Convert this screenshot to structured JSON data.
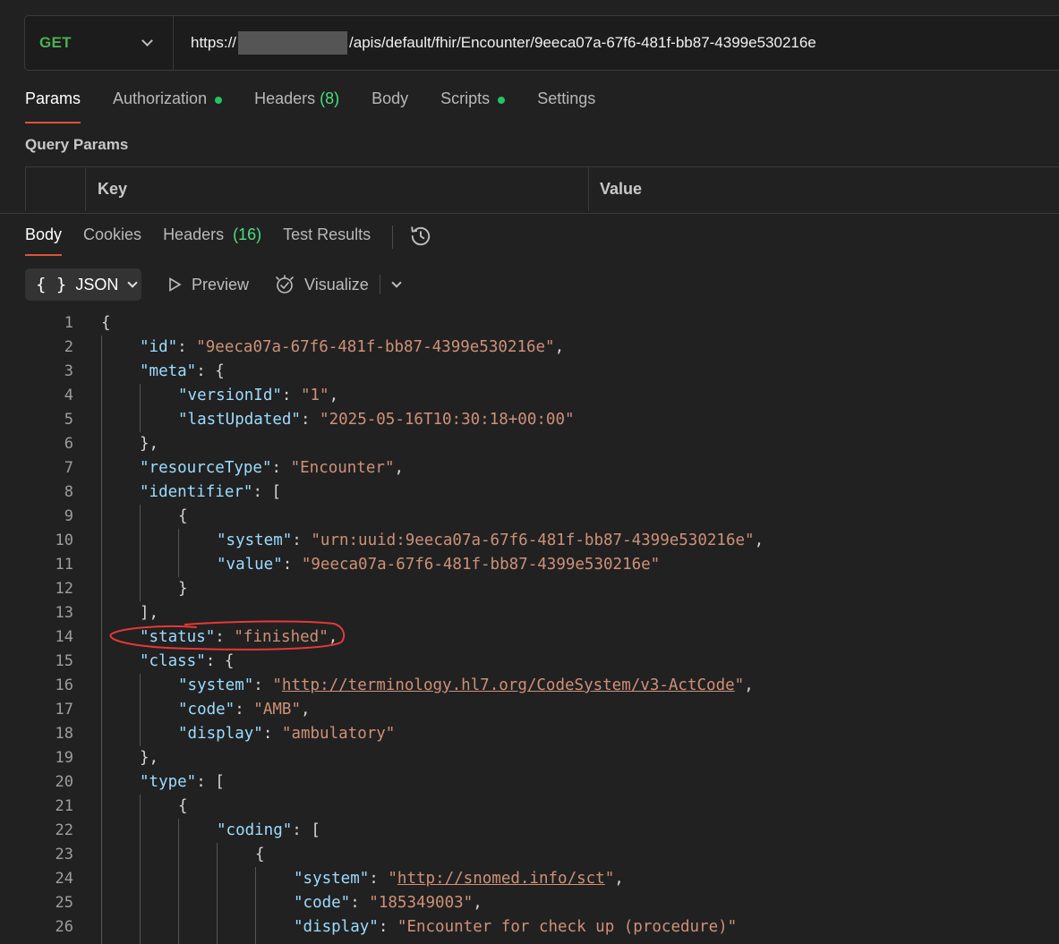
{
  "request": {
    "method": "GET",
    "url_prefix": "https://",
    "url_suffix": "/apis/default/fhir/Encounter/9eeca07a-67f6-481f-bb87-4399e530216e"
  },
  "request_tabs": {
    "params": "Params",
    "authorization": "Authorization",
    "headers": "Headers",
    "headers_count": "(8)",
    "body": "Body",
    "scripts": "Scripts",
    "settings": "Settings"
  },
  "query_params": {
    "title": "Query Params",
    "key_header": "Key",
    "value_header": "Value"
  },
  "response_tabs": {
    "body": "Body",
    "cookies": "Cookies",
    "headers": "Headers",
    "headers_count": "(16)",
    "test_results": "Test Results"
  },
  "toolbar": {
    "format": "JSON",
    "preview": "Preview",
    "visualize": "Visualize"
  },
  "colors": {
    "accent": "#e0533a",
    "method_green": "#4caf50",
    "dot_green": "#22c55e",
    "json_key": "#9cdcfe",
    "json_string": "#ce9178",
    "annotation_red": "#e53935"
  },
  "code_lines": [
    {
      "n": "1",
      "tokens": [
        [
          "p",
          "{"
        ]
      ]
    },
    {
      "n": "2",
      "tokens": [
        [
          "k",
          "\"id\""
        ],
        [
          "p",
          ": "
        ],
        [
          "s",
          "\"9eeca07a-67f6-481f-bb87-4399e530216e\""
        ],
        [
          "p",
          ","
        ]
      ]
    },
    {
      "n": "3",
      "tokens": [
        [
          "k",
          "\"meta\""
        ],
        [
          "p",
          ": {"
        ]
      ]
    },
    {
      "n": "4",
      "tokens": [
        [
          "k",
          "\"versionId\""
        ],
        [
          "p",
          ": "
        ],
        [
          "s",
          "\"1\""
        ],
        [
          "p",
          ","
        ]
      ]
    },
    {
      "n": "5",
      "tokens": [
        [
          "k",
          "\"lastUpdated\""
        ],
        [
          "p",
          ": "
        ],
        [
          "s",
          "\"2025-05-16T10:30:18+00:00\""
        ]
      ]
    },
    {
      "n": "6",
      "tokens": [
        [
          "p",
          "},"
        ]
      ]
    },
    {
      "n": "7",
      "tokens": [
        [
          "k",
          "\"resourceType\""
        ],
        [
          "p",
          ": "
        ],
        [
          "s",
          "\"Encounter\""
        ],
        [
          "p",
          ","
        ]
      ]
    },
    {
      "n": "8",
      "tokens": [
        [
          "k",
          "\"identifier\""
        ],
        [
          "p",
          ": ["
        ]
      ]
    },
    {
      "n": "9",
      "tokens": [
        [
          "p",
          "{"
        ]
      ]
    },
    {
      "n": "10",
      "tokens": [
        [
          "k",
          "\"system\""
        ],
        [
          "p",
          ": "
        ],
        [
          "s",
          "\"urn:uuid:9eeca07a-67f6-481f-bb87-4399e530216e\""
        ],
        [
          "p",
          ","
        ]
      ]
    },
    {
      "n": "11",
      "tokens": [
        [
          "k",
          "\"value\""
        ],
        [
          "p",
          ": "
        ],
        [
          "s",
          "\"9eeca07a-67f6-481f-bb87-4399e530216e\""
        ]
      ]
    },
    {
      "n": "12",
      "tokens": [
        [
          "p",
          "}"
        ]
      ]
    },
    {
      "n": "13",
      "tokens": [
        [
          "p",
          "],"
        ]
      ]
    },
    {
      "n": "14",
      "tokens": [
        [
          "k",
          "\"status\""
        ],
        [
          "p",
          ": "
        ],
        [
          "s",
          "\"finished\""
        ],
        [
          "p",
          ","
        ]
      ]
    },
    {
      "n": "15",
      "tokens": [
        [
          "k",
          "\"class\""
        ],
        [
          "p",
          ": {"
        ]
      ]
    },
    {
      "n": "16",
      "tokens": [
        [
          "k",
          "\"system\""
        ],
        [
          "p",
          ": "
        ],
        [
          "s",
          "\""
        ],
        [
          "link",
          "http://terminology.hl7.org/CodeSystem/v3-ActCode"
        ],
        [
          "s",
          "\""
        ],
        [
          "p",
          ","
        ]
      ]
    },
    {
      "n": "17",
      "tokens": [
        [
          "k",
          "\"code\""
        ],
        [
          "p",
          ": "
        ],
        [
          "s",
          "\"AMB\""
        ],
        [
          "p",
          ","
        ]
      ]
    },
    {
      "n": "18",
      "tokens": [
        [
          "k",
          "\"display\""
        ],
        [
          "p",
          ": "
        ],
        [
          "s",
          "\"ambulatory\""
        ]
      ]
    },
    {
      "n": "19",
      "tokens": [
        [
          "p",
          "},"
        ]
      ]
    },
    {
      "n": "20",
      "tokens": [
        [
          "k",
          "\"type\""
        ],
        [
          "p",
          ": ["
        ]
      ]
    },
    {
      "n": "21",
      "tokens": [
        [
          "p",
          "{"
        ]
      ]
    },
    {
      "n": "22",
      "tokens": [
        [
          "k",
          "\"coding\""
        ],
        [
          "p",
          ": ["
        ]
      ]
    },
    {
      "n": "23",
      "tokens": [
        [
          "p",
          "{"
        ]
      ]
    },
    {
      "n": "24",
      "tokens": [
        [
          "k",
          "\"system\""
        ],
        [
          "p",
          ": "
        ],
        [
          "s",
          "\""
        ],
        [
          "link",
          "http://snomed.info/sct"
        ],
        [
          "s",
          "\""
        ],
        [
          "p",
          ","
        ]
      ]
    },
    {
      "n": "25",
      "tokens": [
        [
          "k",
          "\"code\""
        ],
        [
          "p",
          ": "
        ],
        [
          "s",
          "\"185349003\""
        ],
        [
          "p",
          ","
        ]
      ]
    },
    {
      "n": "26",
      "tokens": [
        [
          "k",
          "\"display\""
        ],
        [
          "p",
          ": "
        ],
        [
          "s",
          "\"Encounter for check up (procedure)\""
        ]
      ]
    }
  ]
}
